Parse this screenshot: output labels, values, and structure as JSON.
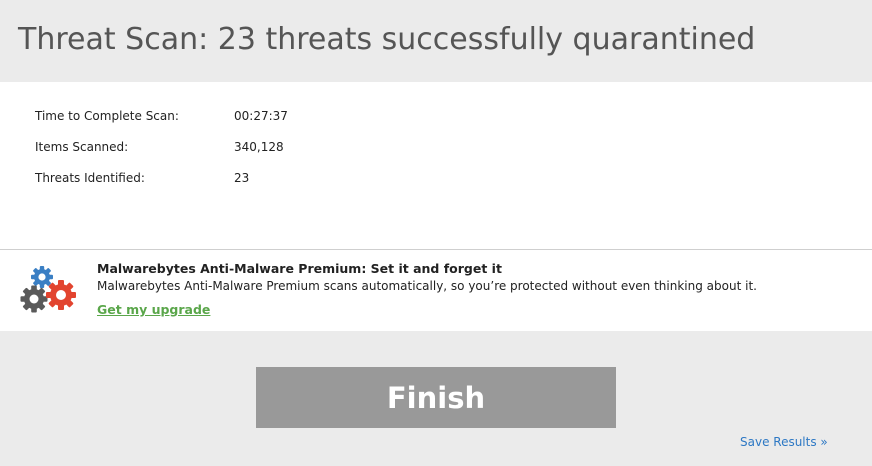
{
  "header": {
    "title": "Threat Scan: 23 threats successfully quarantined"
  },
  "stats": [
    {
      "label": "Time to Complete Scan:",
      "value": "00:27:37"
    },
    {
      "label": "Items Scanned:",
      "value": "340,128"
    },
    {
      "label": "Threats Identified:",
      "value": "23"
    }
  ],
  "promo": {
    "icon": "gears-icon",
    "title": "Malwarebytes Anti-Malware Premium: Set it and forget it",
    "description": "Malwarebytes Anti-Malware Premium scans automatically, so you’re protected without even thinking about it.",
    "link_label": "Get my upgrade"
  },
  "footer": {
    "finish_label": "Finish",
    "save_results_label": "Save Results »"
  },
  "colors": {
    "background": "#ebebeb",
    "panel": "#ffffff",
    "finish_button": "#999999",
    "link_green": "#5aa64a",
    "link_blue": "#2d78c4",
    "gear_blue": "#3a7fc4",
    "gear_red": "#e2442f",
    "gear_gray": "#5a5a5a"
  }
}
